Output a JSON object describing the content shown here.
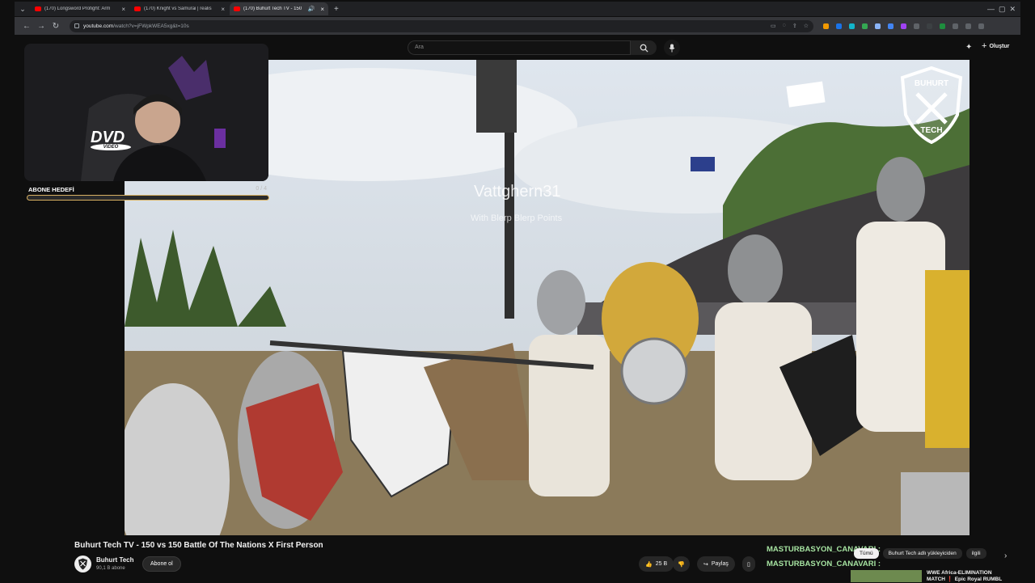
{
  "browser": {
    "tabs": [
      {
        "title": "(170) Longsword Profight: Arm",
        "active": false
      },
      {
        "title": "(170) Knight vs Samurai | realis",
        "active": false
      },
      {
        "title": "(170) Buhurt Tech TV - 150",
        "active": true
      }
    ],
    "url_host": "youtube.com",
    "url_path": "/watch?v=jFWpkWEA5xg&t=10s"
  },
  "youtube": {
    "search_placeholder": "Ara",
    "create_label": "Oluştur"
  },
  "video": {
    "overlay_title": "Vattghern31",
    "overlay_subtitle": "With Blerp Blerp Points",
    "logo_text": "BUHURT TECH",
    "title": "Buhurt Tech TV - 150 vs 150 Battle Of The Nations X First Person",
    "channel_name": "Buhurt Tech",
    "channel_subs": "90,1 B abone",
    "subscribe_label": "Abone ol",
    "like_count": "25 B",
    "share_label": "Paylaş"
  },
  "stream_overlay": {
    "webcam_badge": "DVD",
    "webcam_badge_sub": "VIDEO",
    "sub_goal_label": "ABONE HEDEFİ",
    "sub_goal_count": "0 / 4",
    "sub_goal_progress": 0.0,
    "chat_lines": [
      "MASTURBASYON_CANAVARI :",
      "MASTURBASYON_CANAVARI :"
    ]
  },
  "related": {
    "chips": [
      {
        "label": "Tümü",
        "active": true
      },
      {
        "label": "Buhurt Tech adlı yükleyiciden",
        "active": false
      },
      {
        "label": "ilgili",
        "active": false
      }
    ],
    "first_title_line1": "WWE Africa-ELIMINATION",
    "first_title_line2": "MATCH ❗ Epic Royal RUMBL"
  },
  "colors": {
    "accent_red": "#ff0000",
    "sub_goal_gold": "#d7b062",
    "chat_green": "#a6e3a1"
  }
}
